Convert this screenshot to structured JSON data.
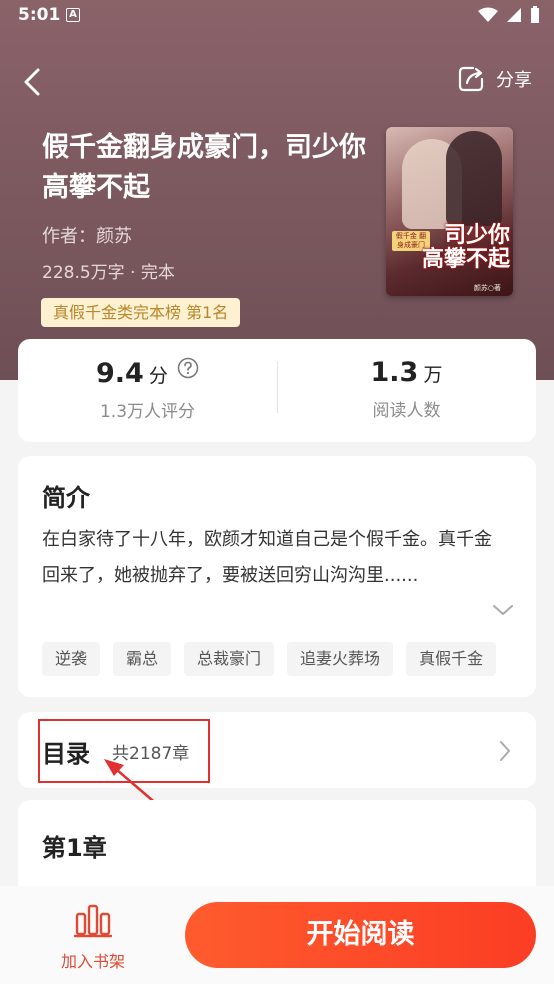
{
  "status_bar": {
    "time": "5:01",
    "a_label": "A"
  },
  "header": {
    "share_label": "分享"
  },
  "book": {
    "title": "假千金翻身成豪门，司少你高攀不起",
    "author": "作者：颜苏",
    "meta": "228.5万字 · 完本",
    "rank_badge": "真假千金类完本榜  第1名",
    "cover": {
      "badge": "假千金 翻身成豪门",
      "title_line1": "司少你",
      "title_line2": "高攀不起",
      "signature": "颜苏○著"
    }
  },
  "stats": {
    "score_value": "9.4",
    "score_unit": "分",
    "score_sub": "1.3万人评分",
    "readers_value": "1.3",
    "readers_unit": "万",
    "readers_sub": "阅读人数"
  },
  "intro": {
    "heading": "简介",
    "text": "在白家待了十八年，欧颜才知道自己是个假千金。真千金回来了，她被抛弃了，要被送回穷山沟沟里......",
    "tags": [
      "逆袭",
      "霸总",
      "总裁豪门",
      "追妻火葬场",
      "真假千金"
    ]
  },
  "toc": {
    "title": "目录",
    "count": "共2187章"
  },
  "chapter": {
    "title": "第1章"
  },
  "bottom": {
    "shelf_label": "加入书架",
    "read_label": "开始阅读"
  },
  "colors": {
    "accent": "#fb3d24",
    "hero_bg": "#7d5a60",
    "annotation": "#e03030"
  }
}
